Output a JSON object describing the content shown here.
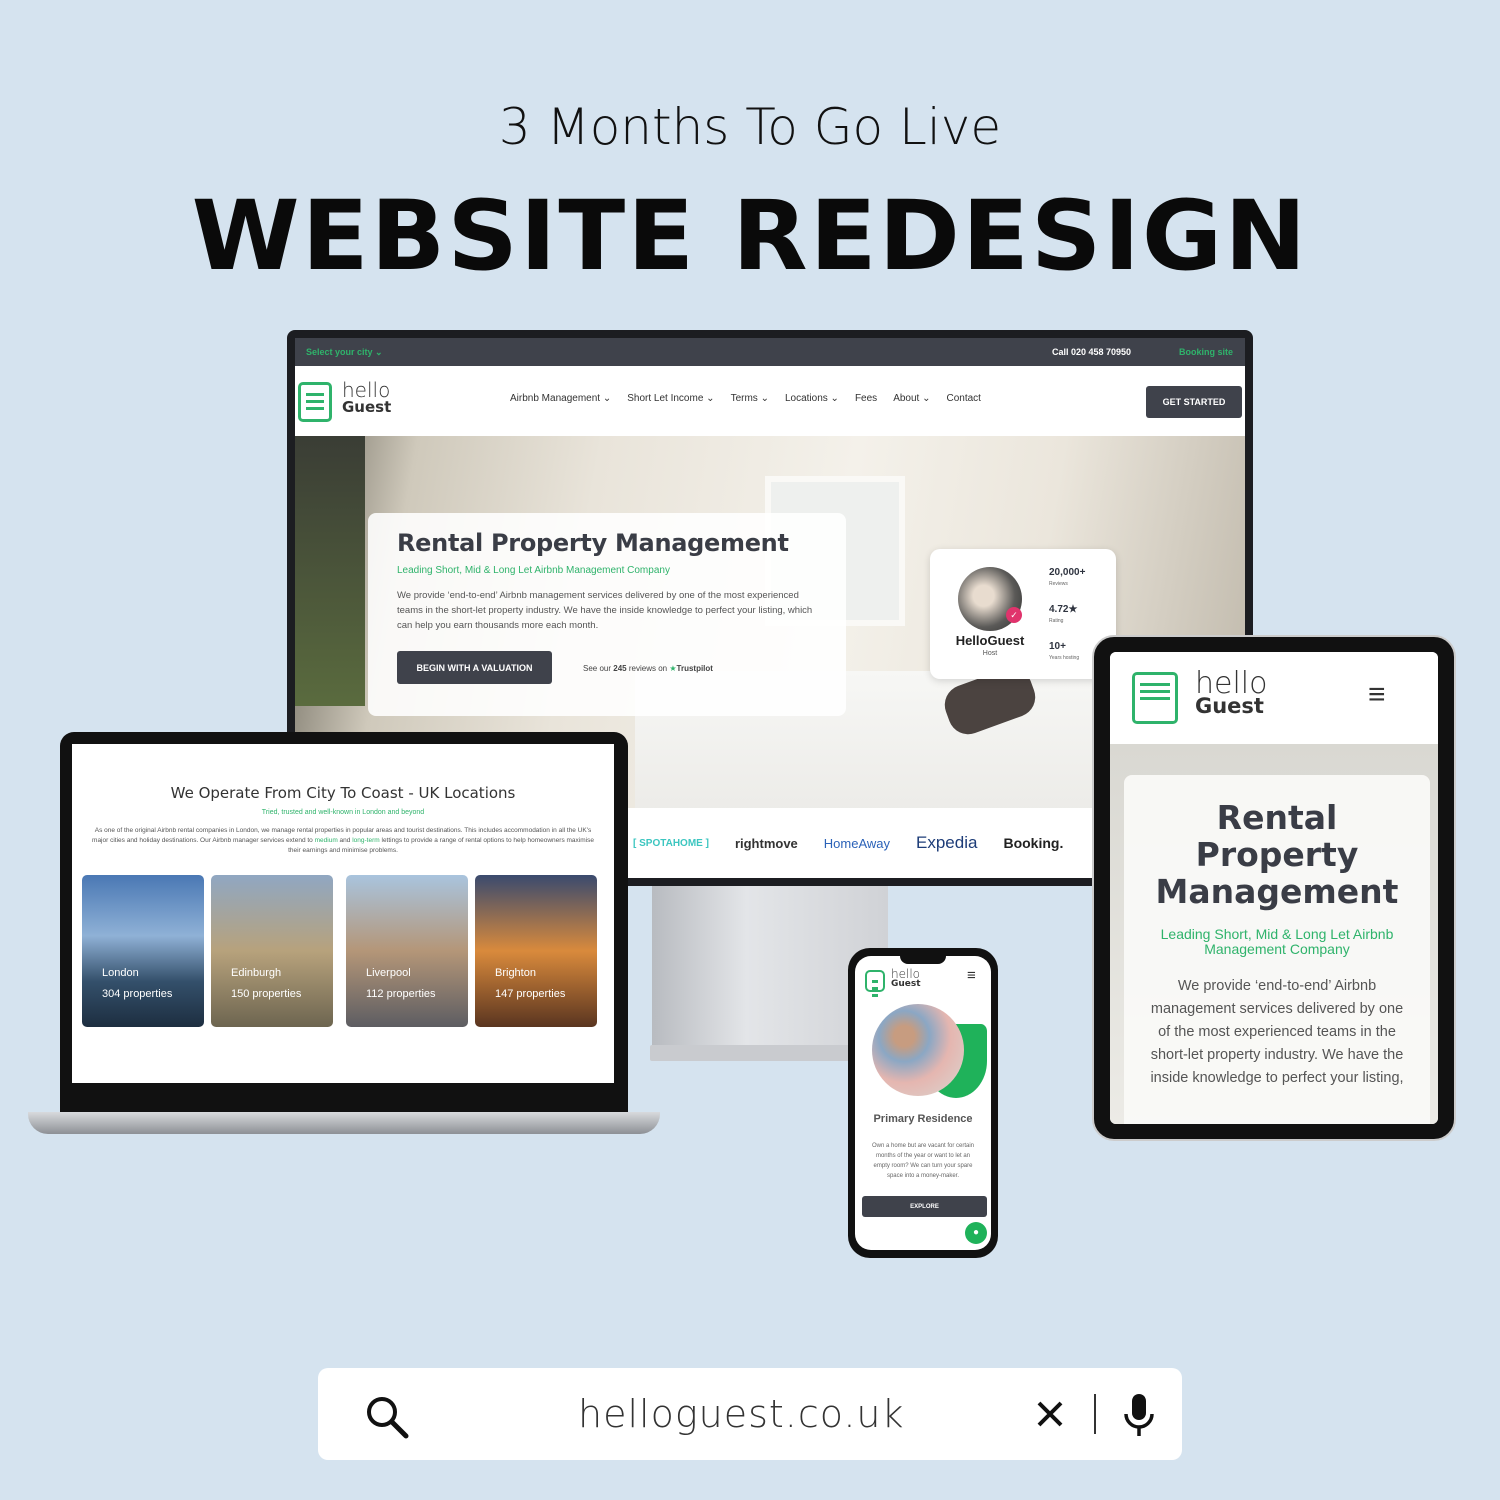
{
  "header": {
    "subtitle": "3 Months To Go Live",
    "title": "WEBSITE REDESIGN"
  },
  "desktop": {
    "topbar": {
      "city_select": "Select your city",
      "phone": "Call 020 458 70950",
      "booking": "Booking site"
    },
    "logo": {
      "line1": "hello",
      "line2": "Guest"
    },
    "nav": [
      "Airbnb Management",
      "Short Let Income",
      "Terms",
      "Locations",
      "Fees",
      "About",
      "Contact"
    ],
    "nav_dropdowns": [
      true,
      true,
      true,
      true,
      false,
      true,
      false
    ],
    "cta": "GET STARTED",
    "hero": {
      "title": "Rental Property Management",
      "tagline": "Leading Short, Mid & Long Let Airbnb Management Company",
      "body": "We provide ‘end-to-end’ Airbnb management services delivered by one of the most experienced teams in the short-let property industry. We have the inside knowledge to perfect your listing, which can help you earn thousands more each month.",
      "button": "BEGIN WITH A VALUATION",
      "reviews_prefix": "See our",
      "reviews_count": "245",
      "reviews_suffix": "reviews on",
      "trustpilot": "Trustpilot"
    },
    "host_card": {
      "name": "HelloGuest",
      "role": "Host",
      "stats": [
        {
          "value": "20,000+",
          "label": "Reviews"
        },
        {
          "value": "4.72★",
          "label": "Rating"
        },
        {
          "value": "10+",
          "label": "Years hosting"
        }
      ]
    },
    "partners": [
      "[ SPOTAHOME ]",
      "rightmove",
      "HomeAway",
      "Expedia",
      "Booking."
    ]
  },
  "laptop": {
    "title": "We Operate From City To Coast - UK Locations",
    "tagline": "Tried, trusted and well-known in London and beyond",
    "body_1": "As one of the original Airbnb rental companies in London, we manage rental properties in popular areas and tourist destinations. This includes accommodation in all the UK's major cities and holiday destinations. Our Airbnb manager services extend to",
    "link_1": "medium",
    "and": "and",
    "link_2": "long-term",
    "body_2": "lettings to provide a range of rental options to help homeowners maximise their earnings and minimise problems.",
    "cities": [
      {
        "name": "London",
        "count": "304 properties"
      },
      {
        "name": "Edinburgh",
        "count": "150 properties"
      },
      {
        "name": "Liverpool",
        "count": "112 properties"
      },
      {
        "name": "Brighton",
        "count": "147 properties"
      }
    ]
  },
  "tablet": {
    "logo": {
      "line1": "hello",
      "line2": "Guest"
    },
    "title": "Rental Property Management",
    "tagline": "Leading Short, Mid & Long Let Airbnb Management Company",
    "body": "We provide ‘end-to-end’ Airbnb management services delivered by one of the most experienced teams in the short-let property industry. We have the inside knowledge to perfect your listing,"
  },
  "phone": {
    "logo": {
      "line1": "hello",
      "line2": "Guest"
    },
    "title": "Primary Residence",
    "body": "Own a home but are vacant for certain months of the year or want to let an empty room? We can turn your spare space into a money-maker.",
    "button": "EXPLORE"
  },
  "search": {
    "query": "helloguest.co.uk"
  },
  "colors": {
    "brand_green": "#2fb36b",
    "dark": "#3f424b",
    "background": "#d5e3ef"
  }
}
